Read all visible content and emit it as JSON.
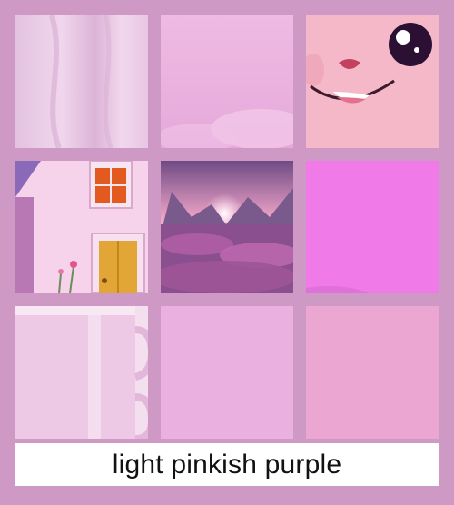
{
  "caption": {
    "text": "light pinkish purple"
  },
  "colors": {
    "page_background": "#cf99c6",
    "swatch_main": "#eba7dc",
    "swatch_magenta": "#ef7ae8"
  },
  "tiles": [
    {
      "name": "tile-fabric",
      "depiction": "soft lilac fabric drape"
    },
    {
      "name": "tile-pink-sky",
      "depiction": "pink cloudy sky texture"
    },
    {
      "name": "tile-cartoon-face",
      "depiction": "cute cartoon face with big eye and smile"
    },
    {
      "name": "tile-cottage",
      "depiction": "pink cottage with window, door and flowers"
    },
    {
      "name": "tile-landscape",
      "depiction": "sunset mountain valley with pink heather"
    },
    {
      "name": "tile-magenta-swatch",
      "depiction": "flat magenta swatch"
    },
    {
      "name": "tile-mug",
      "depiction": "glossy pink ceramic mug"
    },
    {
      "name": "tile-swatch-light",
      "depiction": "plain light pinkish purple swatch"
    },
    {
      "name": "tile-swatch-rose",
      "depiction": "plain pinkish swatch"
    }
  ]
}
